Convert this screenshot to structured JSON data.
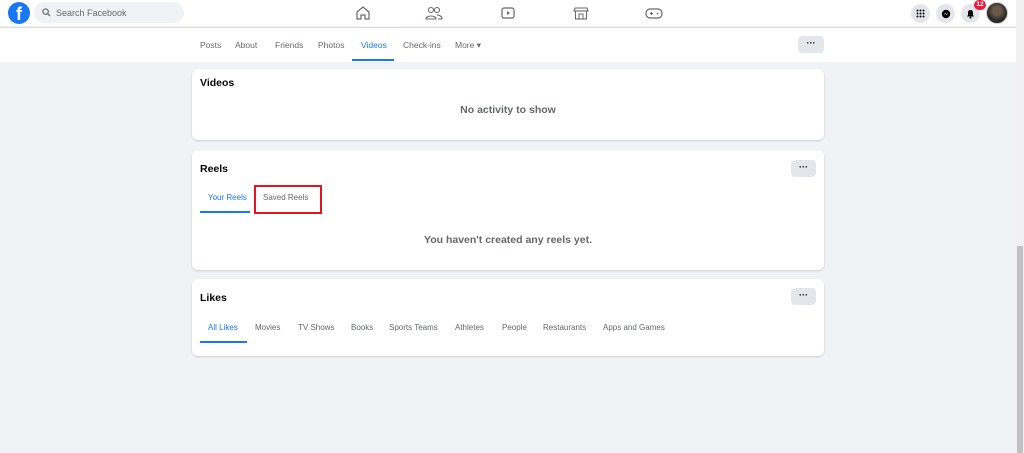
{
  "search": {
    "placeholder": "Search Facebook"
  },
  "header": {
    "notification_count": "12"
  },
  "profile_tabs": {
    "items": [
      "Posts",
      "About",
      "Friends",
      "Photos",
      "Videos",
      "Check-ins",
      "More ▾"
    ],
    "active": "Videos",
    "more_label": "···"
  },
  "videos_card": {
    "title": "Videos",
    "empty_text": "No activity to show"
  },
  "reels_card": {
    "title": "Reels",
    "tabs": [
      "Your Reels",
      "Saved Reels"
    ],
    "active_tab": "Your Reels",
    "empty_text": "You haven't created any reels yet.",
    "more_label": "···"
  },
  "likes_card": {
    "title": "Likes",
    "tabs": [
      "All Likes",
      "Movies",
      "TV Shows",
      "Books",
      "Sports Teams",
      "Athletes",
      "People",
      "Restaurants",
      "Apps and Games"
    ],
    "active_tab": "All Likes",
    "more_label": "···"
  },
  "colors": {
    "accent": "#1877f2",
    "highlight": "#e4141e",
    "background": "#f0f2f5"
  }
}
